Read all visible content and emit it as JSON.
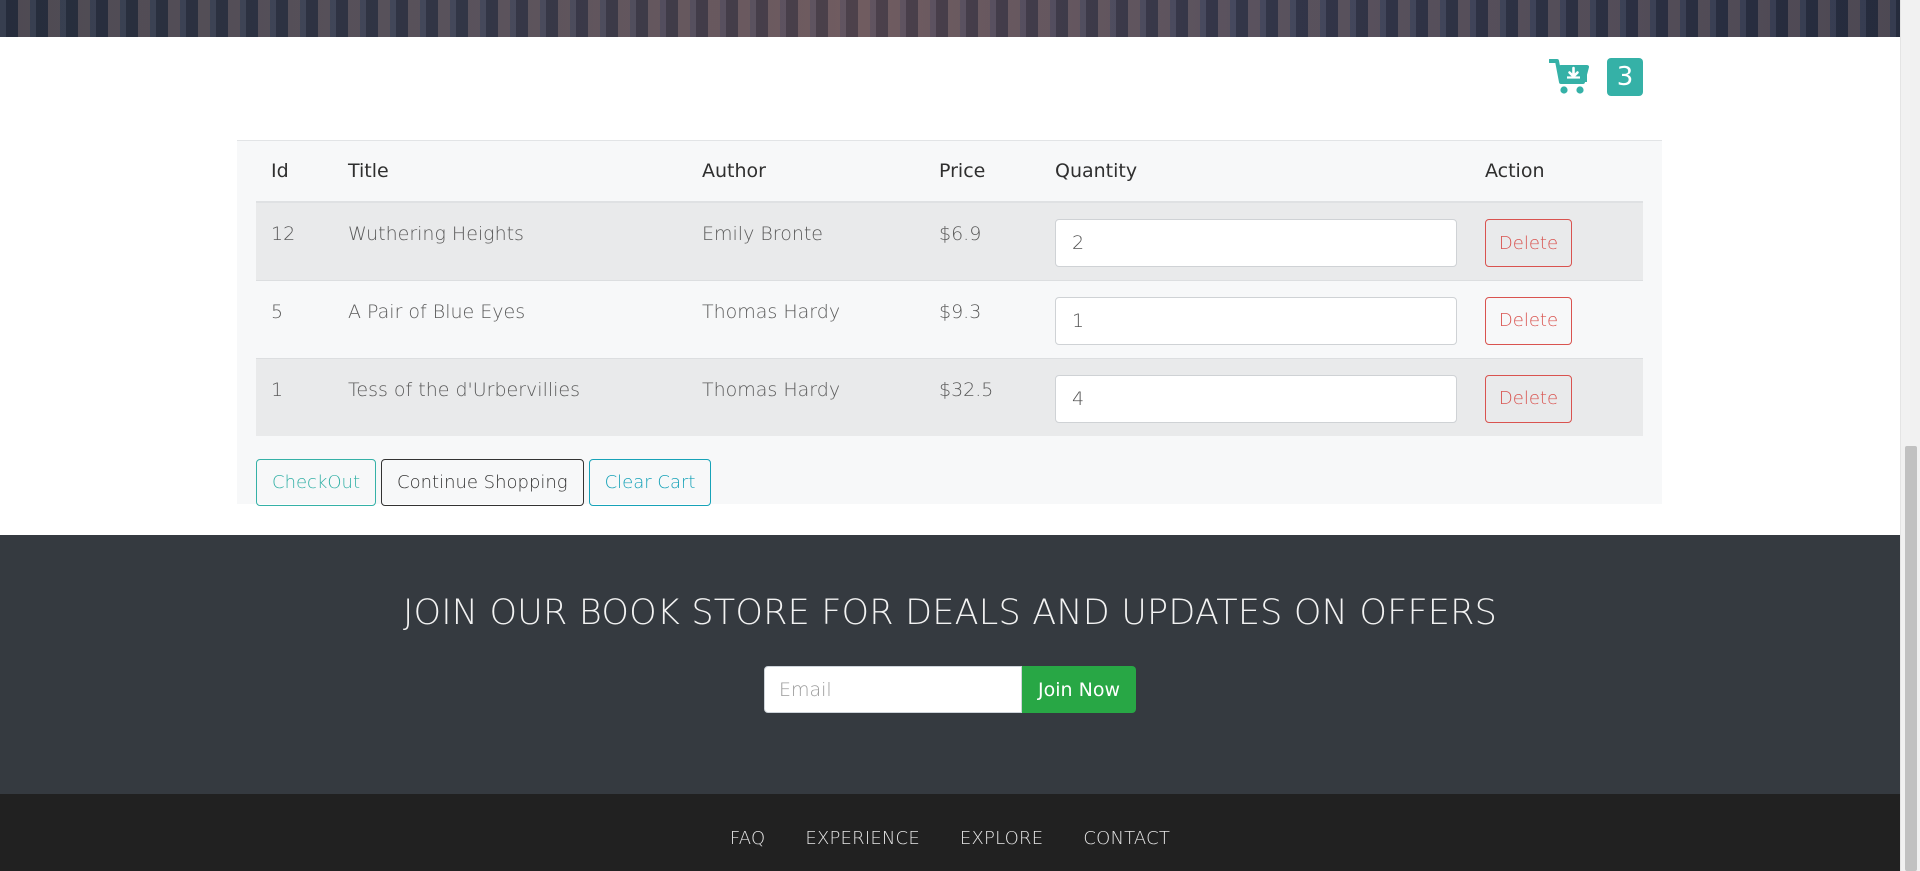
{
  "cart": {
    "count": "3",
    "columns": [
      "Id",
      "Title",
      "Author",
      "Price",
      "Quantity",
      "Action"
    ],
    "items": [
      {
        "id": "12",
        "title": "Wuthering Heights",
        "author": "Emily Bronte",
        "price": "$6.9",
        "quantity": "2",
        "action": "Delete"
      },
      {
        "id": "5",
        "title": "A Pair of Blue Eyes",
        "author": "Thomas Hardy",
        "price": "$9.3",
        "quantity": "1",
        "action": "Delete"
      },
      {
        "id": "1",
        "title": "Tess of the d'Urbervillies",
        "author": "Thomas Hardy",
        "price": "$32.5",
        "quantity": "4",
        "action": "Delete"
      }
    ],
    "buttons": {
      "checkout": "CheckOut",
      "continue_shopping": "Continue Shopping",
      "clear_cart": "Clear Cart"
    }
  },
  "newsletter": {
    "heading": "JOIN OUR BOOK STORE FOR DEALS AND UPDATES ON OFFERS",
    "email_placeholder": "Email",
    "join_label": "Join Now"
  },
  "footer": {
    "links": [
      "FAQ",
      "EXPERIENCE",
      "EXPLORE",
      "CONTACT"
    ]
  },
  "colors": {
    "accent": "#35b1a7",
    "danger": "#d9534f",
    "success": "#28a745",
    "info": "#17a2b8",
    "newsletter_bg": "#353a40",
    "footer_bg": "#212121"
  },
  "icons": {
    "cart": "cart-download-icon"
  }
}
